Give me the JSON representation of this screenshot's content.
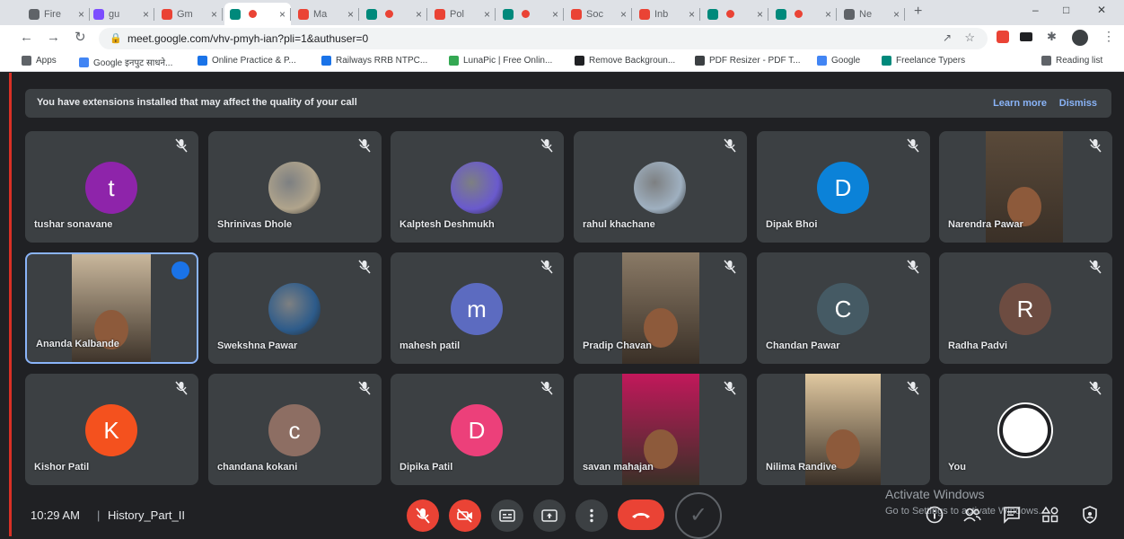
{
  "tabs": [
    {
      "label": "Fire",
      "fav": "#5f6368",
      "active": false
    },
    {
      "label": "gu",
      "fav": "#7c4dff",
      "active": false
    },
    {
      "label": "Gm",
      "fav": "#ea4335",
      "active": false
    },
    {
      "label": "",
      "fav": "#00897b",
      "active": true
    },
    {
      "label": "Ma",
      "fav": "#ea4335",
      "active": false
    },
    {
      "label": "",
      "fav": "#00897b",
      "active": false
    },
    {
      "label": "Pol",
      "fav": "#ea4335",
      "active": false
    },
    {
      "label": "",
      "fav": "#00897b",
      "active": false
    },
    {
      "label": "Soc",
      "fav": "#ea4335",
      "active": false
    },
    {
      "label": "Inb",
      "fav": "#ea4335",
      "active": false
    },
    {
      "label": "",
      "fav": "#00897b",
      "active": false
    },
    {
      "label": "",
      "fav": "#00897b",
      "active": false
    },
    {
      "label": "Ne",
      "fav": "#5f6368",
      "active": false
    }
  ],
  "address": {
    "url": "meet.google.com/vhv-pmyh-ian?pli=1&authuser=0"
  },
  "bookmarks": [
    {
      "label": "Apps",
      "color": "#5f6368"
    },
    {
      "label": "Google इनपुट साधने...",
      "color": "#4285f4"
    },
    {
      "label": "Online Practice & P...",
      "color": "#1a73e8"
    },
    {
      "label": "Railways RRB NTPC...",
      "color": "#1a73e8"
    },
    {
      "label": "LunaPic | Free Onlin...",
      "color": "#34a853"
    },
    {
      "label": "Remove Backgroun...",
      "color": "#202124"
    },
    {
      "label": "PDF Resizer - PDF T...",
      "color": "#3c4043"
    },
    {
      "label": "Google",
      "color": "#4285f4"
    },
    {
      "label": "Freelance Typers",
      "color": "#00897b"
    },
    {
      "label": "Reading list",
      "color": "#5f6368"
    }
  ],
  "banner": {
    "text": "You have extensions installed that may affect the quality of your call",
    "learn_more": "Learn more",
    "dismiss": "Dismiss"
  },
  "participants": [
    {
      "name": "tushar sonavane",
      "initial": "t",
      "color": "#8e24aa",
      "kind": "letter"
    },
    {
      "name": "Shrinivas Dhole",
      "initial": "",
      "color": "#b0a48c",
      "kind": "photo"
    },
    {
      "name": "Kalptesh Deshmukh",
      "initial": "",
      "color": "#6a5acd",
      "kind": "photo"
    },
    {
      "name": "rahul khachane",
      "initial": "",
      "color": "#9fb0c0",
      "kind": "photo"
    },
    {
      "name": "Dipak Bhoi",
      "initial": "D",
      "color": "#0b82d8",
      "kind": "letter"
    },
    {
      "name": "Narendra Pawar",
      "initial": "",
      "color": "#5a4a3a",
      "kind": "video"
    },
    {
      "name": "Ananda Kalbande",
      "initial": "",
      "color": "#c9b79c",
      "kind": "video",
      "speaking": true
    },
    {
      "name": "Swekshna Pawar",
      "initial": "",
      "color": "#2d5b8a",
      "kind": "photo"
    },
    {
      "name": "mahesh patil",
      "initial": "m",
      "color": "#5c6bc0",
      "kind": "letter"
    },
    {
      "name": "Pradip Chavan",
      "initial": "",
      "color": "#8a7a66",
      "kind": "video"
    },
    {
      "name": "Chandan Pawar",
      "initial": "C",
      "color": "#455a64",
      "kind": "letter"
    },
    {
      "name": "Radha Padvi",
      "initial": "R",
      "color": "#6d4c41",
      "kind": "letter"
    },
    {
      "name": "Kishor Patil",
      "initial": "K",
      "color": "#f4511e",
      "kind": "letter"
    },
    {
      "name": "chandana kokani",
      "initial": "c",
      "color": "#8d6e63",
      "kind": "letter"
    },
    {
      "name": "Dipika Patil",
      "initial": "D",
      "color": "#ec407a",
      "kind": "letter"
    },
    {
      "name": "savan mahajan",
      "initial": "",
      "color": "#c2185b",
      "kind": "video"
    },
    {
      "name": "Nilima Randive",
      "initial": "",
      "color": "#e0c8a0",
      "kind": "video"
    },
    {
      "name": "You",
      "initial": "",
      "color": "#ffffff",
      "kind": "logo"
    }
  ],
  "footer": {
    "time": "10:29 AM",
    "separator": "|",
    "meeting_name": "History_Part_II"
  },
  "watermark": {
    "line1": "Activate Windows",
    "line2": "Go to Settings to activate Windows."
  },
  "colors": {
    "accent": "#8ab4f8",
    "danger": "#ea4335",
    "tile": "#3c4043",
    "bg": "#202124"
  }
}
